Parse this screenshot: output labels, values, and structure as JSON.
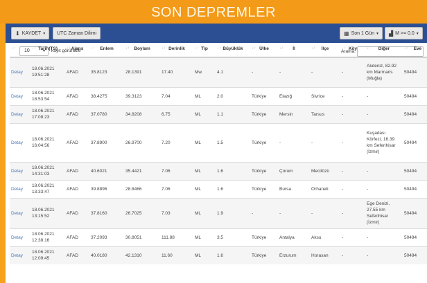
{
  "page": {
    "title": "SON DEPREMLER"
  },
  "toolbar": {
    "save_label": "KAYDET",
    "utc_label": "UTC Zaman Dilimi",
    "period_label": "Son 1 Gün",
    "mag_label": "M >= 0.0"
  },
  "controls": {
    "length_value": "10",
    "length_label": "kayıt görüntüle",
    "search_label": "Arama:",
    "search_value": ""
  },
  "columns": [
    "",
    "Tarih(TS)",
    "Ajans",
    "Enlem",
    "Boylam",
    "Derinlik",
    "Tip",
    "Büyüklük",
    "Ülke",
    "İl",
    "İlçe",
    "Köy",
    "Diğer",
    "Eve"
  ],
  "rows": [
    {
      "detail": "Detay",
      "date": "18.06.2021",
      "time": "19:51:28",
      "agency": "AFAD",
      "lat": "35.8123",
      "lon": "28.1391",
      "depth": "17.40",
      "type": "Mw",
      "mag": "4.1",
      "country": "-",
      "city": "-",
      "district": "-",
      "village": "-",
      "other": "Akdeniz, 82.92 km Marmaris (Muğla)",
      "event": "50494"
    },
    {
      "detail": "Detay",
      "date": "18.06.2021",
      "time": "18:53:54",
      "agency": "AFAD",
      "lat": "38.4275",
      "lon": "39.3123",
      "depth": "7.04",
      "type": "ML",
      "mag": "2.0",
      "country": "Türkiye",
      "city": "Elazığ",
      "district": "Sivrice",
      "village": "-",
      "other": "-",
      "event": "50494"
    },
    {
      "detail": "Detay",
      "date": "18.06.2021",
      "time": "17:08:23",
      "agency": "AFAD",
      "lat": "37.0780",
      "lon": "34.8208",
      "depth": "6.75",
      "type": "ML",
      "mag": "1.1",
      "country": "Türkiye",
      "city": "Mersin",
      "district": "Tarsus",
      "village": "-",
      "other": "-",
      "event": "50494"
    },
    {
      "detail": "Detay",
      "date": "18.06.2021",
      "time": "16:04:56",
      "agency": "AFAD",
      "lat": "37.8900",
      "lon": "26.9700",
      "depth": "7.20",
      "type": "ML",
      "mag": "1.5",
      "country": "Türkiye",
      "city": "-",
      "district": "-",
      "village": "-",
      "other": "Kuşadası Körfezi, 16.39 km Seferihisar (İzmir)",
      "event": "50494"
    },
    {
      "detail": "Detay",
      "date": "18.06.2021",
      "time": "14:31:03",
      "agency": "AFAD",
      "lat": "40.6021",
      "lon": "35.4421",
      "depth": "7.06",
      "type": "ML",
      "mag": "1.6",
      "country": "Türkiye",
      "city": "Çorum",
      "district": "Mecitözü",
      "village": "-",
      "other": "-",
      "event": "50494"
    },
    {
      "detail": "Detay",
      "date": "18.06.2021",
      "time": "13:33:47",
      "agency": "AFAD",
      "lat": "39.8896",
      "lon": "28.8466",
      "depth": "7.06",
      "type": "ML",
      "mag": "1.6",
      "country": "Türkiye",
      "city": "Bursa",
      "district": "Orhaneli",
      "village": "-",
      "other": "-",
      "event": "50494"
    },
    {
      "detail": "Detay",
      "date": "18.06.2021",
      "time": "13:15:52",
      "agency": "AFAD",
      "lat": "37.8160",
      "lon": "26.7025",
      "depth": "7.03",
      "type": "ML",
      "mag": "1.9",
      "country": "-",
      "city": "-",
      "district": "-",
      "village": "-",
      "other": "Ege Denizi, 27.55 km Seferihisar (İzmir)",
      "event": "50494"
    },
    {
      "detail": "Detay",
      "date": "18.06.2021",
      "time": "12:38:16",
      "agency": "AFAD",
      "lat": "37.2093",
      "lon": "30.8051",
      "depth": "111.88",
      "type": "ML",
      "mag": "3.5",
      "country": "Türkiye",
      "city": "Antalya",
      "district": "Aksu",
      "village": "-",
      "other": "-",
      "event": "50494"
    },
    {
      "detail": "Detay",
      "date": "18.06.2021",
      "time": "12:09:45",
      "agency": "AFAD",
      "lat": "40.0180",
      "lon": "42.1310",
      "depth": "11.60",
      "type": "ML",
      "mag": "1.6",
      "country": "Türkiye",
      "city": "Erzurum",
      "district": "Horasan",
      "village": "-",
      "other": "-",
      "event": "50494"
    }
  ]
}
